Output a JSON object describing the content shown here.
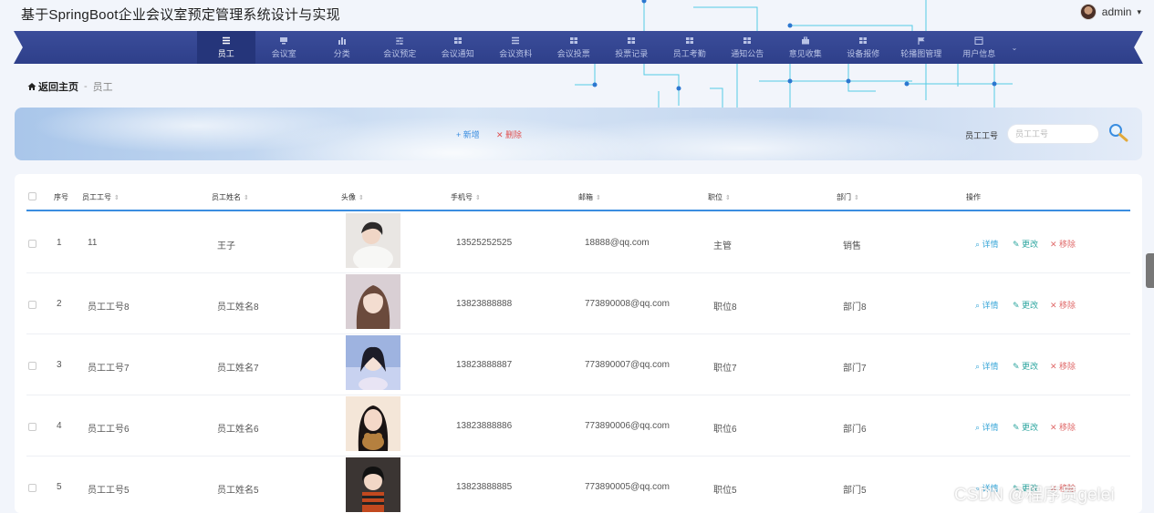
{
  "app": {
    "title": "基于SpringBoot企业会议室预定管理系统设计与实现"
  },
  "user": {
    "name": "admin",
    "caret": "▾"
  },
  "nav": {
    "items": [
      {
        "label": "员工",
        "icon": "list-icon",
        "active": true
      },
      {
        "label": "会议室",
        "icon": "monitor-icon"
      },
      {
        "label": "分类",
        "icon": "bar-chart-icon"
      },
      {
        "label": "会议预定",
        "icon": "sliders-icon"
      },
      {
        "label": "会议通知",
        "icon": "grid-icon"
      },
      {
        "label": "会议资料",
        "icon": "list-icon"
      },
      {
        "label": "会议投票",
        "icon": "grid-icon"
      },
      {
        "label": "投票记录",
        "icon": "grid-icon"
      },
      {
        "label": "员工考勤",
        "icon": "grid-icon"
      },
      {
        "label": "通知公告",
        "icon": "grid-icon"
      },
      {
        "label": "意见收集",
        "icon": "briefcase-icon"
      },
      {
        "label": "设备报修",
        "icon": "grid-icon"
      },
      {
        "label": "轮播图管理",
        "icon": "flag-icon"
      },
      {
        "label": "用户信息",
        "icon": "window-icon"
      }
    ],
    "more": "⌄"
  },
  "breadcrumb": {
    "home": "返回主页",
    "separator": "-",
    "current": "员工"
  },
  "toolbar": {
    "add_label": "+ 新增",
    "delete_label": "✕ 删除"
  },
  "search": {
    "label": "员工工号",
    "placeholder": "员工工号"
  },
  "table": {
    "headers": [
      "序号",
      "员工工号",
      "员工姓名",
      "头像",
      "手机号",
      "邮箱",
      "职位",
      "部门",
      "操作"
    ],
    "sort_glyph": "⇕",
    "rows": [
      {
        "index": "1",
        "emp_no": "11",
        "name": "王子",
        "phone": "13525252525",
        "email": "18888@qq.com",
        "position": "主管",
        "dept": "销售"
      },
      {
        "index": "2",
        "emp_no": "员工工号8",
        "name": "员工姓名8",
        "phone": "13823888888",
        "email": "773890008@qq.com",
        "position": "职位8",
        "dept": "部门8"
      },
      {
        "index": "3",
        "emp_no": "员工工号7",
        "name": "员工姓名7",
        "phone": "13823888887",
        "email": "773890007@qq.com",
        "position": "职位7",
        "dept": "部门7"
      },
      {
        "index": "4",
        "emp_no": "员工工号6",
        "name": "员工姓名6",
        "phone": "13823888886",
        "email": "773890006@qq.com",
        "position": "职位6",
        "dept": "部门6"
      },
      {
        "index": "5",
        "emp_no": "员工工号5",
        "name": "员工姓名5",
        "phone": "13823888885",
        "email": "773890005@qq.com",
        "position": "职位5",
        "dept": "部门5"
      }
    ],
    "actions": {
      "detail": "⌕ 详情",
      "edit": "✎ 更改",
      "remove": "✕ 移除"
    }
  },
  "watermark": "CSDN @程序员gelei",
  "colors": {
    "nav_bg": "#2e3f8a",
    "nav_active": "#25357a",
    "accent": "#3a8de0",
    "danger": "#e05252"
  }
}
